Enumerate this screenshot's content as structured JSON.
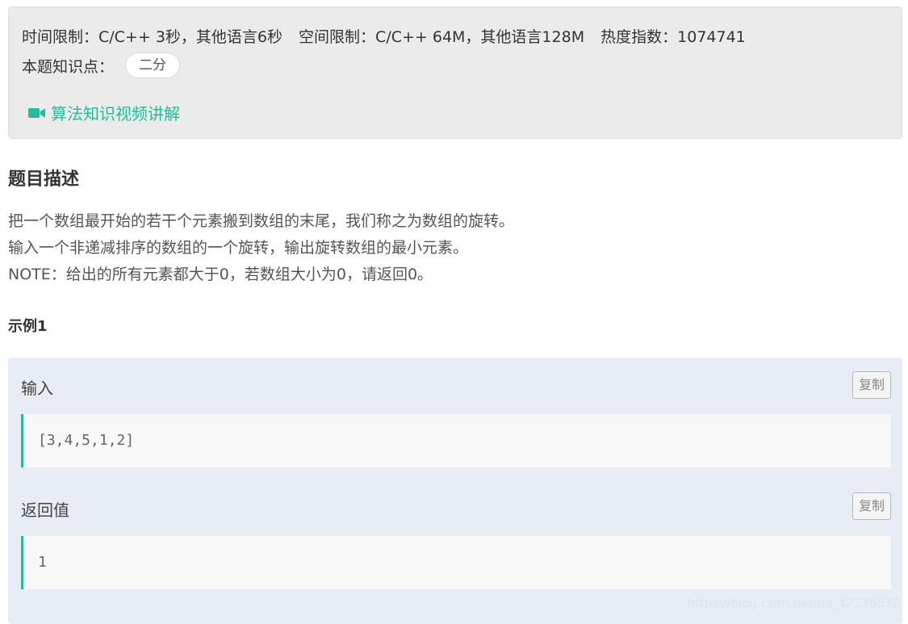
{
  "limits": {
    "time": "时间限制：C/C++ 3秒，其他语言6秒",
    "space": "空间限制：C/C++ 64M，其他语言128M",
    "heat": "热度指数：1074741"
  },
  "knowledge": {
    "label": "本题知识点：",
    "tags": [
      "二分"
    ]
  },
  "video_link": {
    "icon": "video-camera-icon",
    "label": "算法知识视频讲解"
  },
  "description": {
    "title": "题目描述",
    "lines": [
      "把一个数组最开始的若干个元素搬到数组的末尾，我们称之为数组的旋转。",
      "输入一个非递减排序的数组的一个旋转，输出旋转数组的最小元素。",
      "NOTE：给出的所有元素都大于0，若数组大小为0，请返回0。"
    ]
  },
  "example": {
    "title": "示例1",
    "input_label": "输入",
    "input_value": "[3,4,5,1,2]",
    "output_label": "返回值",
    "output_value": "1",
    "copy_label": "复制"
  },
  "watermark": "https://blog.csdn.net/qq_42136832",
  "colors": {
    "accent": "#25bb9b",
    "info_bg": "#ebebeb",
    "example_bg": "#e8edf5"
  }
}
